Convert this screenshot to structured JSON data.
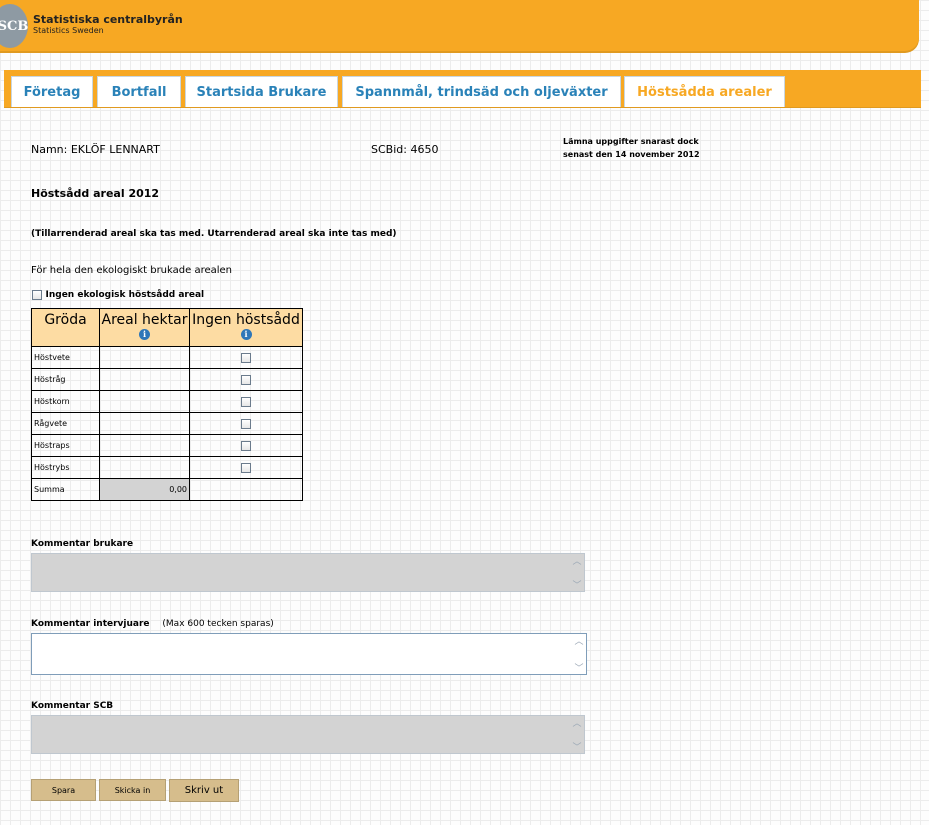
{
  "header": {
    "logo_text": "SCB",
    "title": "Statistiska centralbyrån",
    "subtitle": "Statistics Sweden"
  },
  "tabs": [
    {
      "label": "Företag"
    },
    {
      "label": "Bortfall"
    },
    {
      "label": "Startsida Brukare"
    },
    {
      "label": "Spannmål, trindsäd och oljeväxter"
    },
    {
      "label": "Höstsådda arealer"
    }
  ],
  "info": {
    "name": "Namn: EKLÖF LENNART",
    "scbid": "SCBid: 4650",
    "deadline_line1": "Lämna uppgifter snarast dock",
    "deadline_line2": "senast den 14 november 2012"
  },
  "section": {
    "title": "Höstsådd areal 2012",
    "note": "(Tillarrenderad areal ska tas med. Utarrenderad areal ska inte tas med)",
    "eco_text": "För hela den ekologiskt brukade arealen",
    "no_eco_label": "Ingen ekologisk höstsådd areal"
  },
  "table": {
    "headers": [
      "Gröda",
      "Areal hektar",
      "Ingen höstsådd"
    ],
    "rows": [
      {
        "crop": "Höstvete",
        "area": ""
      },
      {
        "crop": "Höstråg",
        "area": ""
      },
      {
        "crop": "Höstkorn",
        "area": ""
      },
      {
        "crop": "Rågvete",
        "area": ""
      },
      {
        "crop": "Höstraps",
        "area": ""
      },
      {
        "crop": "Höstrybs",
        "area": ""
      }
    ],
    "sum_label": "Summa",
    "sum_value": "0,00"
  },
  "comments": {
    "brukare_label": "Kommentar brukare",
    "intervjuare_label": "Kommentar intervjuare",
    "intervjuare_hint": "(Max 600 tecken sparas)",
    "scb_label": "Kommentar SCB"
  },
  "buttons": {
    "save": "Spara",
    "submit": "Skicka in",
    "print": "Skriv ut"
  }
}
